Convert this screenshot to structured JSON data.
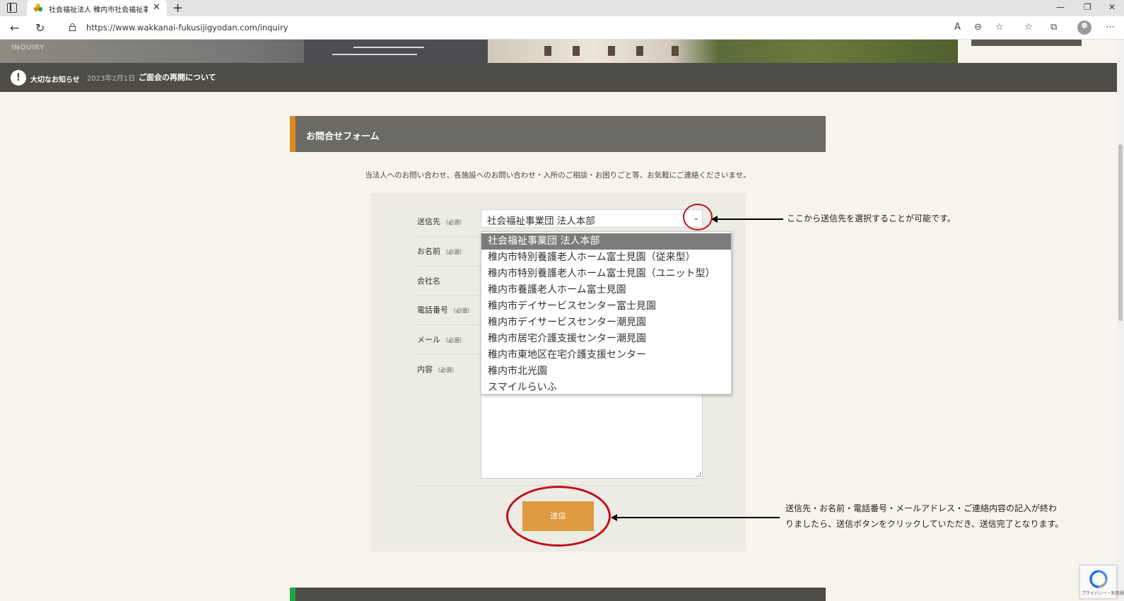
{
  "browser": {
    "tab_title": "社会福祉法人 稚内市社会福祉事業団",
    "url": "https://www.wakkanai-fukusijigyodan.com/inquiry"
  },
  "hero": {
    "label": "INQUIRY"
  },
  "notice": {
    "label": "大切なお知らせ",
    "date": "2023年2月1日",
    "title": "ご面会の再開について"
  },
  "form": {
    "title": "お問合せフォーム",
    "intro": "当法人へのお問い合わせ、各施設へのお問い合わせ・入所のご相談・お困りごと等、お気軽にご連絡くださいませ。",
    "required_mark": "（必須）",
    "labels": {
      "destination": "送信先",
      "name": "お名前",
      "company": "会社名",
      "phone": "電話番号",
      "email": "メール",
      "content": "内容"
    },
    "destination_value": "社会福祉事業団 法人本部",
    "destination_options": [
      "社会福祉事業団 法人本部",
      "稚内市特別養護老人ホーム富士見園（従来型）",
      "稚内市特別養護老人ホーム富士見園（ユニット型）",
      "稚内市養護老人ホーム富士見園",
      "稚内市デイサービスセンター富士見園",
      "稚内市デイサービスセンター潮見園",
      "稚内市居宅介護支援センター潮見園",
      "稚内市東地区在宅介護支援センター",
      "稚内市北光園",
      "スマイルらいふ"
    ],
    "submit_label": "送信"
  },
  "annotations": {
    "select_hint": "ここから送信先を選択することが可能です。",
    "submit_hint_line1": "送信先・お名前・電話番号・メールアドレス・ご連絡内容の記入が終わ",
    "submit_hint_line2": "りましたら、送信ボタンをクリックしていただき、送信完了となります。"
  },
  "recaptcha": {
    "text": "プライバシー・利用規約"
  },
  "colors": {
    "accent_orange": "#e08a1e",
    "button": "#dd9a3e",
    "header_bar": "#6b6a64",
    "notice_bar": "#4e4d47",
    "annotation_red": "#c0101a",
    "accent_green": "#1ea54a"
  }
}
